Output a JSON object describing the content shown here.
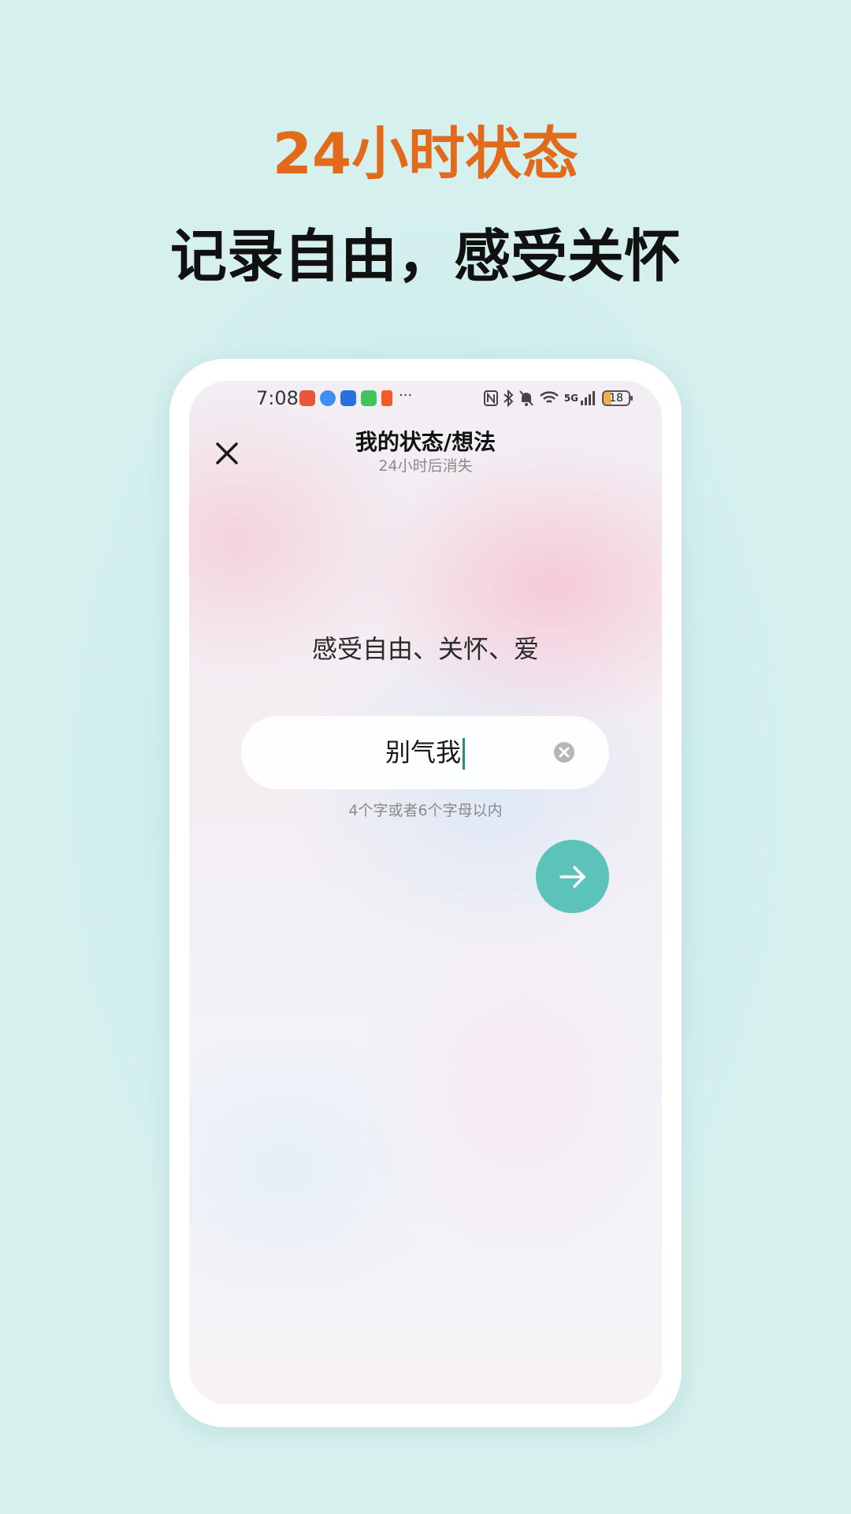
{
  "promo": {
    "headline": "24小时状态",
    "tagline": "记录自由，感受关怀",
    "headline_color": "#e26a1b"
  },
  "status_bar": {
    "time": "7:08",
    "notification_icons": [
      {
        "name": "app-red-icon",
        "color": "#e8553a"
      },
      {
        "name": "message-icon",
        "color": "#3d8ff0"
      },
      {
        "name": "app-blue-icon",
        "color": "#2a6fe0"
      },
      {
        "name": "wechat-icon",
        "color": "#41c45a"
      },
      {
        "name": "app-orange-icon",
        "color": "#f25a2c"
      }
    ],
    "more": "···",
    "signal_label": "5G",
    "battery": "18"
  },
  "header": {
    "title": "我的状态/想法",
    "subtitle": "24小时后消失"
  },
  "main": {
    "prompt": "感受自由、关怀、爱",
    "input_value": "别气我",
    "hint": "4个字或者6个字母以内",
    "accent_color": "#5cc3bb"
  }
}
